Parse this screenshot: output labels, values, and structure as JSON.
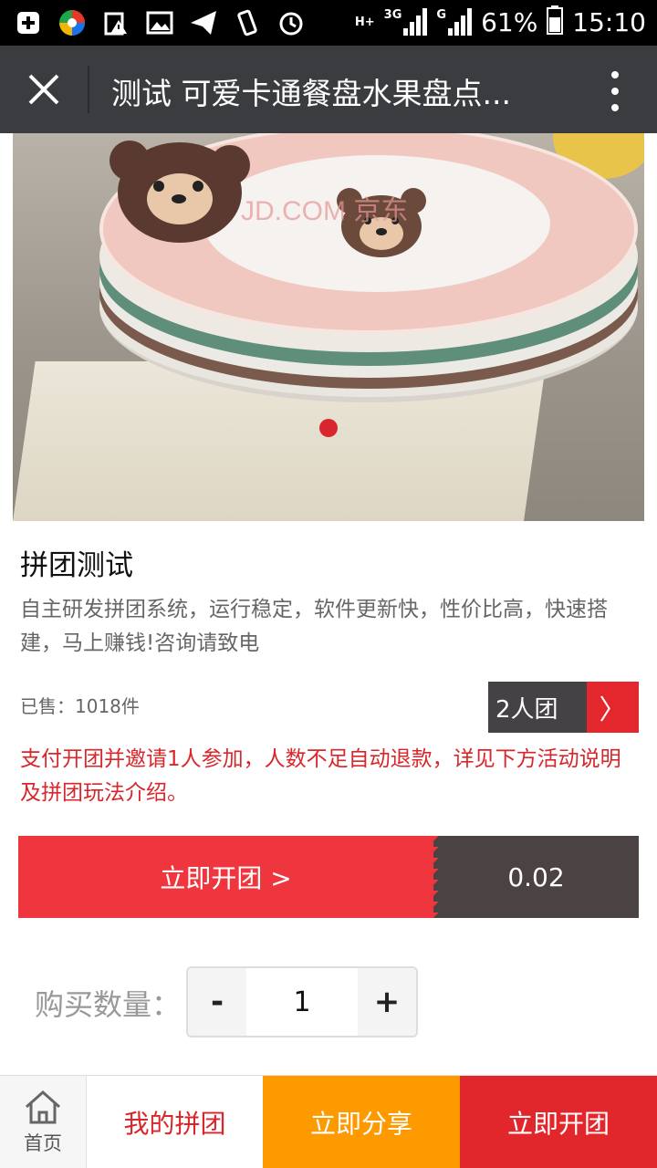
{
  "status_bar": {
    "icons": [
      "add-icon",
      "app-icon",
      "warning-icon",
      "image-icon",
      "send-icon",
      "vibrate-icon",
      "alarm-icon",
      "hplus-icon",
      "signal-3g-icon",
      "signal-g-icon",
      "battery-icon"
    ],
    "network_hplus": "H+",
    "network_3g": "3G",
    "network_g": "G",
    "battery": "61%",
    "time": "15:10"
  },
  "title_bar": {
    "title": "测试 可爱卡通餐盘水果盘点..."
  },
  "product": {
    "watermark": "JD.COM 京东",
    "title": "拼团测试",
    "description": "自主研发拼团系统，运行稳定，软件更新快，性价比高，快速搭建，马上赚钱!咨询请致电",
    "sold": "已售：1018件",
    "group_label": "2人团",
    "group_arrow": "〉",
    "notice": "支付开团并邀请1人参加，人数不足自动退款，详见下方活动说明及拼团玩法介绍。"
  },
  "open_bar": {
    "label": "立即开团 >",
    "price": "0.02"
  },
  "quantity": {
    "label": "购买数量：",
    "minus": "-",
    "value": "1",
    "plus": "+"
  },
  "bottom_nav": {
    "home": "首页",
    "my_group": "我的拼团",
    "share": "立即分享",
    "open": "立即开团"
  },
  "colors": {
    "title_bar_bg": "#3b3c3f",
    "accent_red": "#e1262c",
    "share_orange": "#fd9a00",
    "price_bg": "#4a4243"
  }
}
